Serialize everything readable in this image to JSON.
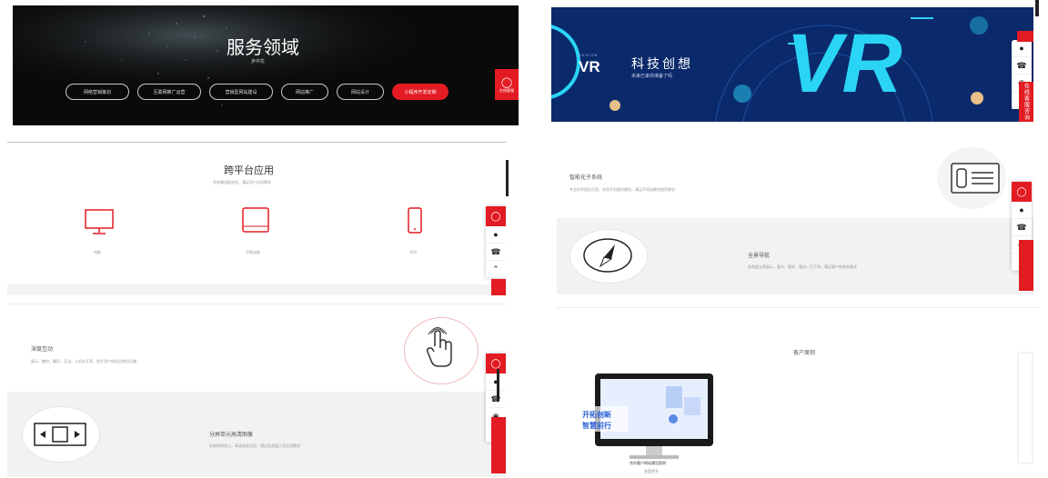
{
  "panel1": {
    "title": "服务领域",
    "subtitle": "步中优",
    "buttons": [
      "网络营销策划",
      "互联网推广运营",
      "营销型网站建设",
      "网站推广",
      "网站设计",
      "小程序开发定制"
    ],
    "active_index": 5,
    "chat_label": "在线客服"
  },
  "panel2": {
    "badge": "VR",
    "badge_design": "DESIGN",
    "title": "科技创想",
    "subtitle": "未来已来你准备了吗",
    "big_text": "VR",
    "side_label": "在线客服咨询"
  },
  "panel3": {
    "title": "跨平台应用",
    "subtitle": "多终端适配浏览，满足用户访问需求",
    "items": [
      "电脑",
      "平板电脑",
      "手机"
    ]
  },
  "panel4": {
    "title": "智能化子系统",
    "desc": "专业技术团队打造，实现手机随时随地，满足不同场景的使用需求",
    "item_title": "全景导航",
    "item_desc": "多角度全景展示，看车、看房、看店一目了然，满足客户的各类需求"
  },
  "panel5": {
    "title": "深度互动",
    "desc": "展示、触控、翻页、互动、人机交互等，提升用户体验及使用乐趣",
    "item_title": "分屏单元高清图像",
    "item_desc": "多屏拼接显示，高清画面呈现，满足各类展示及应用需求"
  },
  "panel6": {
    "title": "客户案例",
    "screen_text_1": "开拓创新",
    "screen_text_2": "智慧前行",
    "caption": "合作客户网站建设案例",
    "caption_sub": "查看更多"
  },
  "colors": {
    "accent": "#e31b23",
    "vr_bg": "#0b2a6b",
    "vr_cyan": "#2ad4f5"
  }
}
